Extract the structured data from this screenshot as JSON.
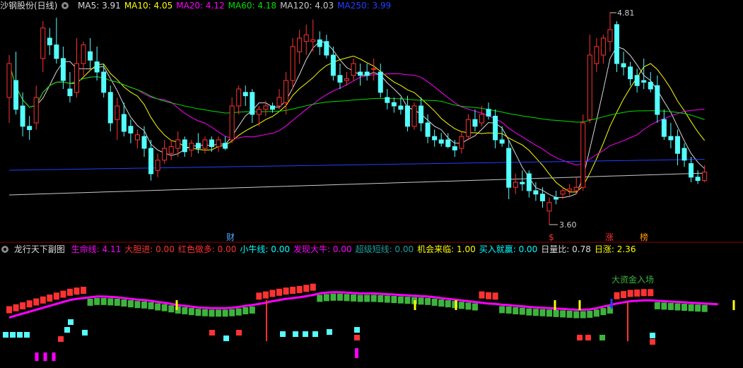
{
  "top_panel": {
    "title": "沙钢股份(日线)",
    "indicators": [
      {
        "label": "MA5:",
        "value": "3.91",
        "color": "#d8d8d8"
      },
      {
        "label": "MA10:",
        "value": "4.05",
        "color": "#ffff00"
      },
      {
        "label": "MA20:",
        "value": "4.12",
        "color": "#ff00ff"
      },
      {
        "label": "MA60:",
        "value": "4.18",
        "color": "#00e000"
      },
      {
        "label": "MA120:",
        "value": "4.03",
        "color": "#c8c8c8"
      },
      {
        "label": "MA250:",
        "value": "3.99",
        "color": "#2040ff"
      }
    ],
    "price_high_label": "4.81",
    "price_low_label": "3.60",
    "markers": [
      {
        "text": "财",
        "color": "#4aa8ff"
      },
      {
        "text": "$",
        "color": "#ff3030"
      },
      {
        "text": "涨",
        "color": "#ff3030"
      },
      {
        "text": "榜",
        "color": "#ff9900"
      }
    ]
  },
  "sub_panel": {
    "title": "龙行天下副图",
    "indicators": [
      {
        "label": "生命线:",
        "value": "4.11",
        "color": "#ff00ff"
      },
      {
        "label": "大胆进:",
        "value": "0.00",
        "color": "#ff3030"
      },
      {
        "label": "红色做多:",
        "value": "0.00",
        "color": "#ff3030"
      },
      {
        "label": "小牛线:",
        "value": "0.00",
        "color": "#00ffff"
      },
      {
        "label": "发现大牛:",
        "value": "0.00",
        "color": "#ff00ff"
      },
      {
        "label": "超级短线:",
        "value": "0.00",
        "color": "#1aa0a0"
      },
      {
        "label": "机会来临:",
        "value": "1.00",
        "color": "#ffff00"
      },
      {
        "label": "买入就赢:",
        "value": "0.00",
        "color": "#00ffff"
      },
      {
        "label": "日量比:",
        "value": "0.78",
        "color": "#dddddd"
      },
      {
        "label": "日涨:",
        "value": "2.36",
        "color": "#ffff00"
      }
    ],
    "annotation": "大资金入场"
  },
  "colors": {
    "up": "#ff3232",
    "down": "#54ffff",
    "green_bar": "#3cb43c",
    "magenta": "#ff00ff",
    "yellow": "#ffff00",
    "blue": "#2040ff"
  },
  "chart_data": {
    "type": "candlestick",
    "y_range": [
      3.55,
      4.85
    ],
    "candles": [
      {
        "o": 4.35,
        "h": 4.6,
        "l": 4.2,
        "c": 4.55
      },
      {
        "o": 4.45,
        "h": 4.62,
        "l": 4.25,
        "c": 4.28
      },
      {
        "o": 4.3,
        "h": 4.38,
        "l": 4.12,
        "c": 4.18
      },
      {
        "o": 4.18,
        "h": 4.24,
        "l": 4.1,
        "c": 4.16
      },
      {
        "o": 4.2,
        "h": 4.42,
        "l": 4.16,
        "c": 4.35
      },
      {
        "o": 4.58,
        "h": 4.8,
        "l": 4.5,
        "c": 4.76
      },
      {
        "o": 4.7,
        "h": 4.76,
        "l": 4.6,
        "c": 4.66
      },
      {
        "o": 4.66,
        "h": 4.82,
        "l": 4.55,
        "c": 4.58
      },
      {
        "o": 4.58,
        "h": 4.65,
        "l": 4.4,
        "c": 4.45
      },
      {
        "o": 4.4,
        "h": 4.5,
        "l": 4.32,
        "c": 4.36
      },
      {
        "o": 4.38,
        "h": 4.7,
        "l": 4.35,
        "c": 4.55
      },
      {
        "o": 4.55,
        "h": 4.68,
        "l": 4.48,
        "c": 4.66
      },
      {
        "o": 4.62,
        "h": 4.7,
        "l": 4.52,
        "c": 4.57
      },
      {
        "o": 4.56,
        "h": 4.65,
        "l": 4.45,
        "c": 4.5
      },
      {
        "o": 4.5,
        "h": 4.55,
        "l": 4.35,
        "c": 4.38
      },
      {
        "o": 4.38,
        "h": 4.42,
        "l": 4.15,
        "c": 4.2
      },
      {
        "o": 4.22,
        "h": 4.35,
        "l": 4.1,
        "c": 4.3
      },
      {
        "o": 4.25,
        "h": 4.32,
        "l": 4.12,
        "c": 4.15
      },
      {
        "o": 4.18,
        "h": 4.22,
        "l": 4.08,
        "c": 4.14
      },
      {
        "o": 4.1,
        "h": 4.16,
        "l": 4.05,
        "c": 4.13
      },
      {
        "o": 4.12,
        "h": 4.18,
        "l": 4.0,
        "c": 4.05
      },
      {
        "o": 4.05,
        "h": 4.1,
        "l": 3.86,
        "c": 3.9
      },
      {
        "o": 3.92,
        "h": 4.02,
        "l": 3.88,
        "c": 3.98
      },
      {
        "o": 3.98,
        "h": 4.1,
        "l": 3.96,
        "c": 4.05
      },
      {
        "o": 4.02,
        "h": 4.1,
        "l": 3.98,
        "c": 4.06
      },
      {
        "o": 4.05,
        "h": 4.15,
        "l": 4.0,
        "c": 4.1
      },
      {
        "o": 4.1,
        "h": 4.12,
        "l": 4.0,
        "c": 4.03
      },
      {
        "o": 4.04,
        "h": 4.1,
        "l": 4.0,
        "c": 4.08
      },
      {
        "o": 4.08,
        "h": 4.14,
        "l": 4.02,
        "c": 4.05
      },
      {
        "o": 4.05,
        "h": 4.12,
        "l": 4.02,
        "c": 4.1
      },
      {
        "o": 4.1,
        "h": 4.12,
        "l": 4.03,
        "c": 4.06
      },
      {
        "o": 4.06,
        "h": 4.12,
        "l": 4.03,
        "c": 4.1
      },
      {
        "o": 4.08,
        "h": 4.12,
        "l": 4.04,
        "c": 4.05
      },
      {
        "o": 4.1,
        "h": 4.35,
        "l": 4.08,
        "c": 4.3
      },
      {
        "o": 4.3,
        "h": 4.42,
        "l": 4.25,
        "c": 4.4
      },
      {
        "o": 4.38,
        "h": 4.42,
        "l": 4.3,
        "c": 4.36
      },
      {
        "o": 4.38,
        "h": 4.4,
        "l": 4.2,
        "c": 4.25
      },
      {
        "o": 4.25,
        "h": 4.3,
        "l": 4.18,
        "c": 4.28
      },
      {
        "o": 4.28,
        "h": 4.33,
        "l": 4.24,
        "c": 4.3
      },
      {
        "o": 4.3,
        "h": 4.32,
        "l": 4.26,
        "c": 4.28
      },
      {
        "o": 4.3,
        "h": 4.4,
        "l": 4.28,
        "c": 4.35
      },
      {
        "o": 4.32,
        "h": 4.5,
        "l": 4.25,
        "c": 4.45
      },
      {
        "o": 4.45,
        "h": 4.7,
        "l": 4.4,
        "c": 4.65
      },
      {
        "o": 4.62,
        "h": 4.75,
        "l": 4.55,
        "c": 4.7
      },
      {
        "o": 4.68,
        "h": 4.78,
        "l": 4.6,
        "c": 4.72
      },
      {
        "o": 4.68,
        "h": 4.81,
        "l": 4.62,
        "c": 4.69
      },
      {
        "o": 4.69,
        "h": 4.74,
        "l": 4.6,
        "c": 4.65
      },
      {
        "o": 4.68,
        "h": 4.72,
        "l": 4.58,
        "c": 4.6
      },
      {
        "o": 4.6,
        "h": 4.65,
        "l": 4.45,
        "c": 4.48
      },
      {
        "o": 4.48,
        "h": 4.55,
        "l": 4.4,
        "c": 4.44
      },
      {
        "o": 4.45,
        "h": 4.5,
        "l": 4.42,
        "c": 4.46
      },
      {
        "o": 4.48,
        "h": 4.58,
        "l": 4.45,
        "c": 4.55
      },
      {
        "o": 4.5,
        "h": 4.55,
        "l": 4.42,
        "c": 4.48
      },
      {
        "o": 4.5,
        "h": 4.55,
        "l": 4.45,
        "c": 4.48
      },
      {
        "o": 4.52,
        "h": 4.58,
        "l": 4.45,
        "c": 4.52
      },
      {
        "o": 4.5,
        "h": 4.55,
        "l": 4.35,
        "c": 4.38
      },
      {
        "o": 4.35,
        "h": 4.4,
        "l": 4.28,
        "c": 4.32
      },
      {
        "o": 4.32,
        "h": 4.35,
        "l": 4.26,
        "c": 4.3
      },
      {
        "o": 4.3,
        "h": 4.35,
        "l": 4.25,
        "c": 4.28
      },
      {
        "o": 4.3,
        "h": 4.36,
        "l": 4.15,
        "c": 4.18
      },
      {
        "o": 4.18,
        "h": 4.32,
        "l": 4.16,
        "c": 4.3
      },
      {
        "o": 4.3,
        "h": 4.35,
        "l": 4.15,
        "c": 4.2
      },
      {
        "o": 4.2,
        "h": 4.25,
        "l": 4.08,
        "c": 4.12
      },
      {
        "o": 4.12,
        "h": 4.16,
        "l": 4.06,
        "c": 4.1
      },
      {
        "o": 4.1,
        "h": 4.14,
        "l": 4.06,
        "c": 4.08
      },
      {
        "o": 4.1,
        "h": 4.14,
        "l": 4.05,
        "c": 4.06
      },
      {
        "o": 4.06,
        "h": 4.1,
        "l": 4.0,
        "c": 4.04
      },
      {
        "o": 4.05,
        "h": 4.15,
        "l": 4.02,
        "c": 4.12
      },
      {
        "o": 4.12,
        "h": 4.25,
        "l": 4.1,
        "c": 4.22
      },
      {
        "o": 4.22,
        "h": 4.28,
        "l": 4.15,
        "c": 4.18
      },
      {
        "o": 4.2,
        "h": 4.3,
        "l": 4.18,
        "c": 4.25
      },
      {
        "o": 4.28,
        "h": 4.32,
        "l": 4.22,
        "c": 4.24
      },
      {
        "o": 4.24,
        "h": 4.28,
        "l": 4.05,
        "c": 4.1
      },
      {
        "o": 4.1,
        "h": 4.18,
        "l": 4.06,
        "c": 4.08
      },
      {
        "o": 4.05,
        "h": 4.1,
        "l": 3.75,
        "c": 3.82
      },
      {
        "o": 3.82,
        "h": 3.9,
        "l": 3.78,
        "c": 3.85
      },
      {
        "o": 3.85,
        "h": 3.92,
        "l": 3.8,
        "c": 3.84
      },
      {
        "o": 3.9,
        "h": 3.92,
        "l": 3.76,
        "c": 3.8
      },
      {
        "o": 3.8,
        "h": 3.85,
        "l": 3.74,
        "c": 3.78
      },
      {
        "o": 3.78,
        "h": 3.82,
        "l": 3.7,
        "c": 3.74
      },
      {
        "o": 3.68,
        "h": 3.76,
        "l": 3.6,
        "c": 3.73
      },
      {
        "o": 3.76,
        "h": 3.8,
        "l": 3.72,
        "c": 3.75
      },
      {
        "o": 3.78,
        "h": 3.82,
        "l": 3.75,
        "c": 3.8
      },
      {
        "o": 3.8,
        "h": 3.84,
        "l": 3.77,
        "c": 3.81
      },
      {
        "o": 3.8,
        "h": 3.88,
        "l": 3.78,
        "c": 3.82
      },
      {
        "o": 3.82,
        "h": 4.25,
        "l": 3.8,
        "c": 4.2
      },
      {
        "o": 4.22,
        "h": 4.72,
        "l": 4.2,
        "c": 4.6
      },
      {
        "o": 4.55,
        "h": 4.7,
        "l": 4.5,
        "c": 4.65
      },
      {
        "o": 4.6,
        "h": 4.72,
        "l": 4.55,
        "c": 4.7
      },
      {
        "o": 4.68,
        "h": 4.85,
        "l": 4.62,
        "c": 4.75
      },
      {
        "o": 4.78,
        "h": 4.8,
        "l": 4.5,
        "c": 4.55
      },
      {
        "o": 4.55,
        "h": 4.62,
        "l": 4.48,
        "c": 4.53
      },
      {
        "o": 4.53,
        "h": 4.56,
        "l": 4.42,
        "c": 4.46
      },
      {
        "o": 4.48,
        "h": 4.52,
        "l": 4.38,
        "c": 4.42
      },
      {
        "o": 4.45,
        "h": 4.58,
        "l": 4.4,
        "c": 4.44
      },
      {
        "o": 4.44,
        "h": 4.5,
        "l": 4.38,
        "c": 4.4
      },
      {
        "o": 4.42,
        "h": 4.48,
        "l": 4.2,
        "c": 4.25
      },
      {
        "o": 4.22,
        "h": 4.28,
        "l": 4.1,
        "c": 4.12
      },
      {
        "o": 4.12,
        "h": 4.2,
        "l": 4.05,
        "c": 4.1
      },
      {
        "o": 4.12,
        "h": 4.16,
        "l": 3.95,
        "c": 4.02
      },
      {
        "o": 4.05,
        "h": 4.08,
        "l": 3.94,
        "c": 3.98
      },
      {
        "o": 3.96,
        "h": 4.0,
        "l": 3.85,
        "c": 3.88
      },
      {
        "o": 3.88,
        "h": 3.92,
        "l": 3.84,
        "c": 3.86
      },
      {
        "o": 3.86,
        "h": 3.95,
        "l": 3.85,
        "c": 3.91
      }
    ],
    "sub_series": {
      "type": "bar",
      "y_range": [
        -1.5,
        1.6
      ],
      "top_red": [
        1,
        1,
        1,
        1,
        1,
        1,
        1,
        1,
        1,
        1,
        1,
        1,
        0,
        0,
        0,
        0,
        0,
        0,
        0,
        0,
        0,
        0,
        0,
        0,
        0,
        0,
        0,
        0,
        0,
        0,
        0,
        0,
        0,
        0,
        0,
        0,
        0,
        1,
        1,
        1,
        1,
        1,
        1,
        1,
        1,
        1,
        0,
        0,
        0,
        0,
        0,
        0,
        0,
        0,
        0,
        0,
        0,
        0,
        0,
        0,
        0,
        0,
        0,
        0,
        0,
        0,
        0,
        0,
        0,
        0,
        1,
        1,
        1,
        0,
        0,
        0,
        0,
        0,
        0,
        0,
        0,
        0,
        0,
        0,
        0,
        0,
        0,
        0,
        0,
        0,
        1,
        1,
        1,
        1,
        1,
        1,
        0,
        0,
        0,
        0,
        0,
        0,
        0,
        0,
        0,
        0
      ],
      "life_line": [
        0.1,
        0.15,
        0.2,
        0.25,
        0.3,
        0.35,
        0.4,
        0.45,
        0.5,
        0.55,
        0.58,
        0.6,
        0.62,
        0.64,
        0.64,
        0.63,
        0.62,
        0.6,
        0.58,
        0.56,
        0.55,
        0.53,
        0.5,
        0.48,
        0.45,
        0.42,
        0.4,
        0.38,
        0.36,
        0.35,
        0.34,
        0.34,
        0.34,
        0.35,
        0.37,
        0.4,
        0.42,
        0.45,
        0.48,
        0.52,
        0.55,
        0.58,
        0.6,
        0.62,
        0.65,
        0.68,
        0.72,
        0.74,
        0.75,
        0.75,
        0.74,
        0.73,
        0.72,
        0.72,
        0.72,
        0.71,
        0.7,
        0.69,
        0.68,
        0.67,
        0.66,
        0.65,
        0.64,
        0.62,
        0.6,
        0.58,
        0.56,
        0.54,
        0.52,
        0.5,
        0.48,
        0.46,
        0.45,
        0.43,
        0.42,
        0.4,
        0.39,
        0.37,
        0.36,
        0.35,
        0.34,
        0.33,
        0.32,
        0.31,
        0.3,
        0.3,
        0.31,
        0.34,
        0.38,
        0.42,
        0.46,
        0.49,
        0.52,
        0.53,
        0.54,
        0.54,
        0.53,
        0.52,
        0.51,
        0.5,
        0.49,
        0.48,
        0.47,
        0.46,
        0.45,
        0.44
      ],
      "signals": [
        "cyan-low",
        "cyan-low",
        "cyan-low",
        "cyan-low",
        "red-low",
        "cyan-mid",
        "cyan-mid",
        "cyan-high"
      ]
    }
  }
}
